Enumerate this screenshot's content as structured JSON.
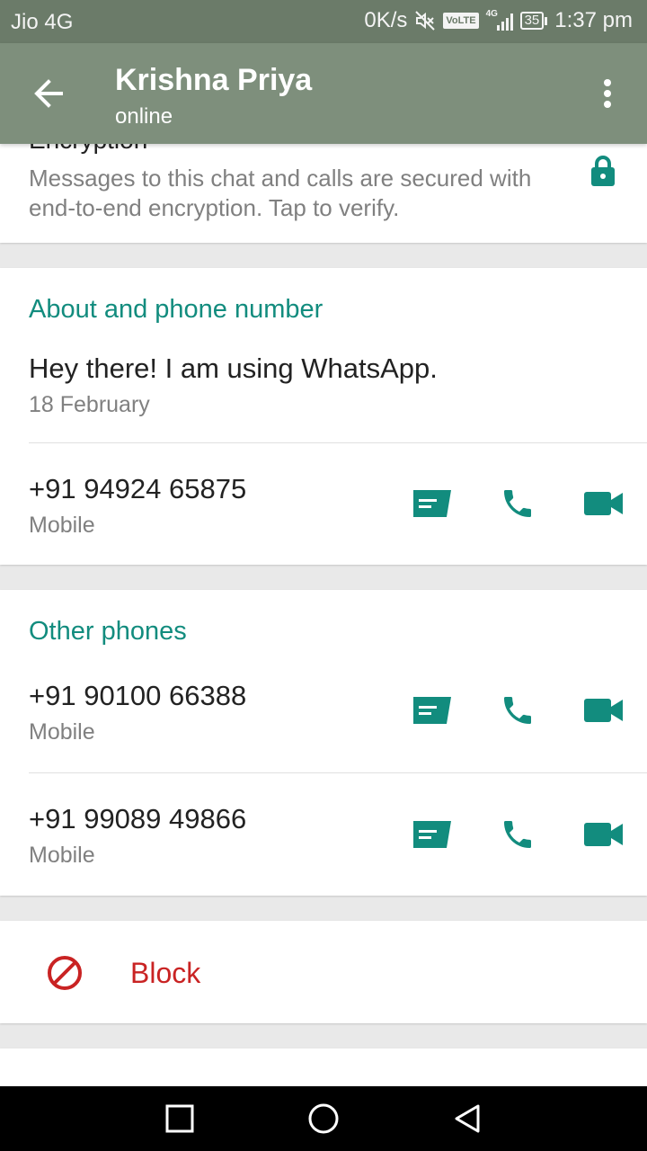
{
  "status_bar": {
    "carrier": "Jio 4G",
    "speed": "0K/s",
    "volte": "VoLTE",
    "network": "4G",
    "battery": "35",
    "time": "1:37 pm"
  },
  "header": {
    "title": "Krishna Priya",
    "subtitle": "online"
  },
  "encryption": {
    "heading": "Encryption",
    "description": "Messages to this chat and calls are secured with end-to-end encryption. Tap to verify."
  },
  "about": {
    "section_title": "About and phone number",
    "status_text": "Hey there! I am using WhatsApp.",
    "status_date": "18 February",
    "phone": "+91 94924 65875",
    "phone_type": "Mobile"
  },
  "other_phones": {
    "section_title": "Other phones",
    "items": [
      {
        "number": "+91 90100 66388",
        "type": "Mobile"
      },
      {
        "number": "+91 99089 49866",
        "type": "Mobile"
      }
    ]
  },
  "block": {
    "label": "Block"
  },
  "colors": {
    "accent": "#128c7e",
    "danger": "#c92323",
    "appbar": "#7e8f7c"
  }
}
